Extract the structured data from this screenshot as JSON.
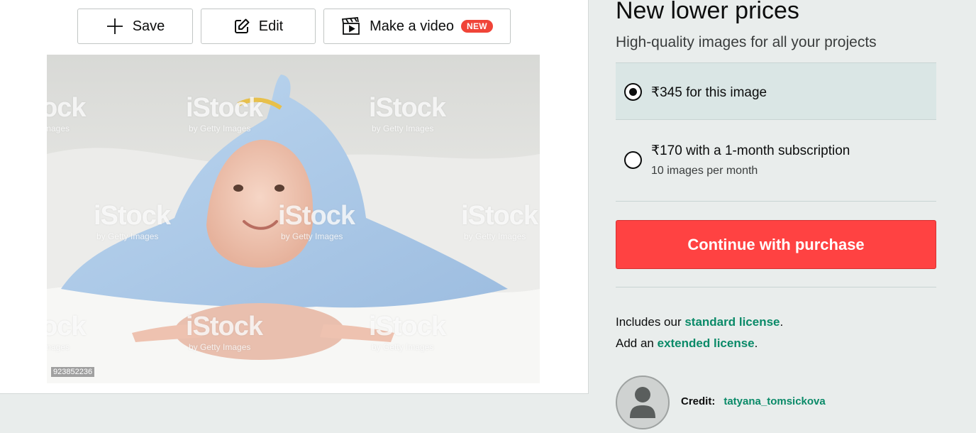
{
  "toolbar": {
    "save_label": "Save",
    "edit_label": "Edit",
    "video_label": "Make a video",
    "new_badge": "NEW",
    "icons": [
      "plus-icon",
      "edit-icon",
      "clapperboard-icon"
    ]
  },
  "image": {
    "id_text": "923852236",
    "watermark": "iStock",
    "watermark_sub": "by Getty Images",
    "watermark_partial": "ock",
    "watermark_partial_sub": "mages"
  },
  "pricing": {
    "title": "New lower prices",
    "subtitle": "High-quality images for all your projects",
    "options": [
      {
        "label": "₹345 for this image",
        "selected": true
      },
      {
        "label": "₹170 with a 1-month subscription",
        "sub": "10 images per month",
        "selected": false
      }
    ],
    "cta_label": "Continue with purchase"
  },
  "license": {
    "line1_prefix": "Includes our ",
    "line1_link": "standard license",
    "line1_suffix": ".",
    "line2_prefix": "Add an ",
    "line2_link": "extended license",
    "line2_suffix": "."
  },
  "credit": {
    "label": "Credit:",
    "name": "tatyana_tomsickova"
  },
  "colors": {
    "accent_red": "#ff4242",
    "link_green": "#0a8a68",
    "selected_bg": "#dae6e5",
    "page_bg": "#e9edec"
  }
}
